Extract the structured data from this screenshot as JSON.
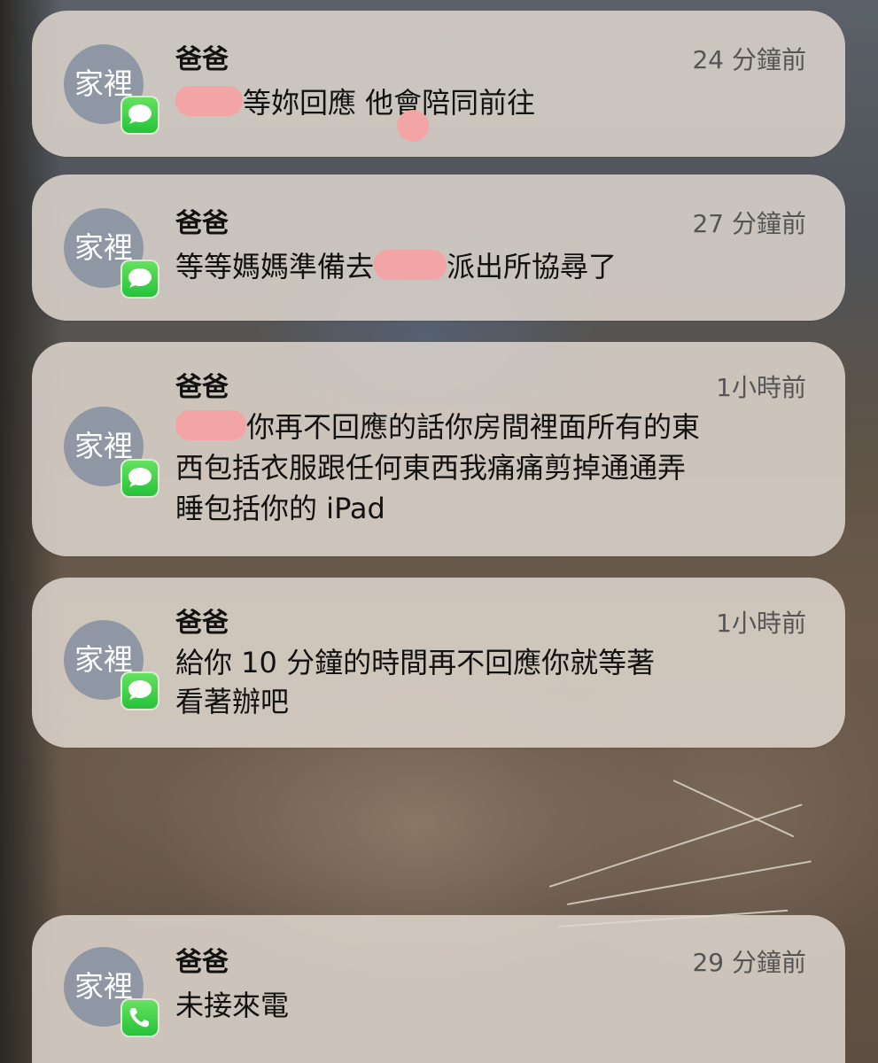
{
  "avatar_label": "家裡",
  "app_icons": {
    "message": "messages-icon",
    "phone": "phone-icon"
  },
  "colors": {
    "card_bg": "#ded6ce",
    "avatar_bg": "#8f96a4",
    "app_green": "#34c759",
    "redaction": "#f3a4a4"
  },
  "notifications": [
    {
      "sender": "爸爸",
      "time": "24 分鐘前",
      "app": "messages",
      "line1": {
        "after": "等妳回應 他會陪同前往"
      }
    },
    {
      "sender": "爸爸",
      "time": "27 分鐘前",
      "app": "messages",
      "line1": {
        "before": "等等媽媽準備去",
        "after": "派出所協尋了"
      }
    },
    {
      "sender": "爸爸",
      "time": "1小時前",
      "app": "messages",
      "line1": {
        "after": "你再不回應的話你房間裡面所有的東"
      },
      "line2": "西包括衣服跟任何東西我痛痛剪掉通通弄",
      "line3": "睡包括你的 iPad"
    },
    {
      "sender": "爸爸",
      "time": "1小時前",
      "app": "messages",
      "line1": "給你 10 分鐘的時間再不回應你就等著",
      "line2": "看著辦吧"
    },
    {
      "sender": "爸爸",
      "time": "29 分鐘前",
      "app": "phone",
      "line1": "未接來電"
    }
  ]
}
